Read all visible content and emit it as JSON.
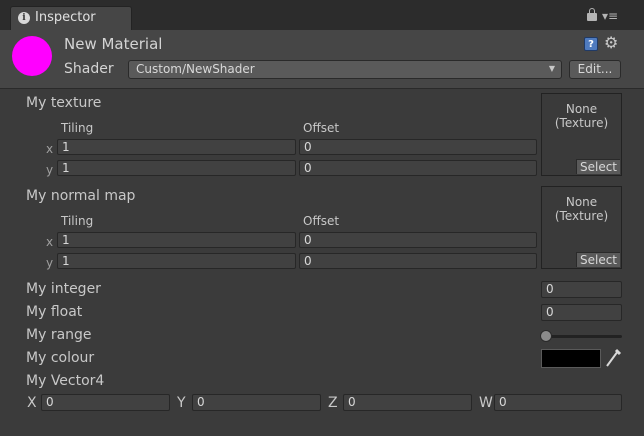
{
  "window": {
    "tab_label": "Inspector",
    "info_icon": "i"
  },
  "header": {
    "material_name": "New Material",
    "material_color": "#ff00ff",
    "shader_label": "Shader",
    "shader_value": "Custom/NewShader",
    "edit_label": "Edit...",
    "help_glyph": "?"
  },
  "textures": [
    {
      "label": "My texture",
      "tiling_label": "Tiling",
      "offset_label": "Offset",
      "tiling_x": "1",
      "tiling_y": "1",
      "offset_x": "0",
      "offset_y": "0",
      "preview_none": "None",
      "preview_type": "(Texture)",
      "select_label": "Select"
    },
    {
      "label": "My normal map",
      "tiling_label": "Tiling",
      "offset_label": "Offset",
      "tiling_x": "1",
      "tiling_y": "1",
      "offset_x": "0",
      "offset_y": "0",
      "preview_none": "None",
      "preview_type": "(Texture)",
      "select_label": "Select"
    }
  ],
  "axis_labels": {
    "x": "x",
    "y": "y"
  },
  "props": {
    "integer_label": "My integer",
    "integer_value": "0",
    "float_label": "My float",
    "float_value": "0",
    "range_label": "My range",
    "range_value": 0.0,
    "colour_label": "My colour",
    "colour_value": "#000000",
    "vector_label": "My Vector4",
    "vector": [
      {
        "axis": "X",
        "value": "0"
      },
      {
        "axis": "Y",
        "value": "0"
      },
      {
        "axis": "Z",
        "value": "0"
      },
      {
        "axis": "W",
        "value": "0"
      }
    ]
  },
  "colors": {
    "background": "#3b3b3b",
    "header_bg": "#464646",
    "field_bg": "#414141"
  }
}
